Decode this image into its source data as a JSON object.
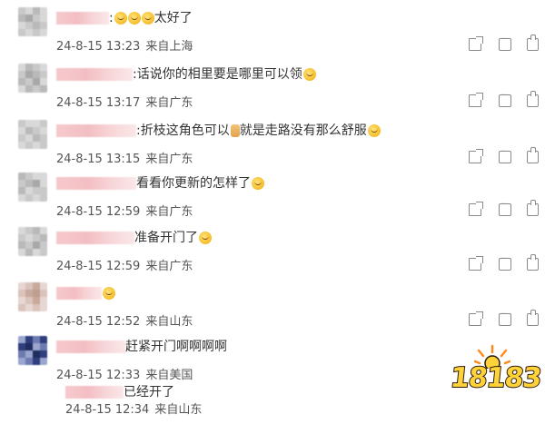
{
  "comments": [
    {
      "username": "",
      "text": "太好了",
      "date": "24-8-15 13:23",
      "location": "来自上海",
      "emojis_before": 3,
      "emojis_after": 0
    },
    {
      "username": "",
      "text": "话说你的相里要是哪里可以领",
      "date": "24-8-15 13:17",
      "location": "来自广东",
      "emojis_before": 0,
      "emojis_after": 1
    },
    {
      "username": "",
      "text": "折枝这角色可以",
      "text2": "就是走路没有那么舒服",
      "date": "24-8-15 13:15",
      "location": "来自广东",
      "emojis_before": 0,
      "emojis_after": 1
    },
    {
      "username": "",
      "text": "看看你更新的怎样了",
      "date": "24-8-15 12:59",
      "location": "来自广东",
      "emojis_before": 0,
      "emojis_after": 1
    },
    {
      "username": "",
      "text": "准备开门了",
      "date": "24-8-15 12:59",
      "location": "来自广东",
      "emojis_before": 0,
      "emojis_after": 1
    },
    {
      "username": "",
      "text": "",
      "date": "24-8-15 12:52",
      "location": "来自山东",
      "emojis_before": 0,
      "emojis_after": 1
    },
    {
      "username": "",
      "text": "赶紧开门啊啊啊啊",
      "date": "24-8-15 12:33",
      "location": "来自美国",
      "emojis_before": 0,
      "emojis_after": 0
    },
    {
      "username": "",
      "text": "已经开了",
      "date": "24-8-15 12:34",
      "location": "来自山东",
      "emojis_before": 0,
      "emojis_after": 0
    }
  ],
  "icons": {
    "share": "share-icon",
    "reply": "comment-icon",
    "like": "like-icon"
  },
  "watermark": {
    "text": "18183"
  }
}
